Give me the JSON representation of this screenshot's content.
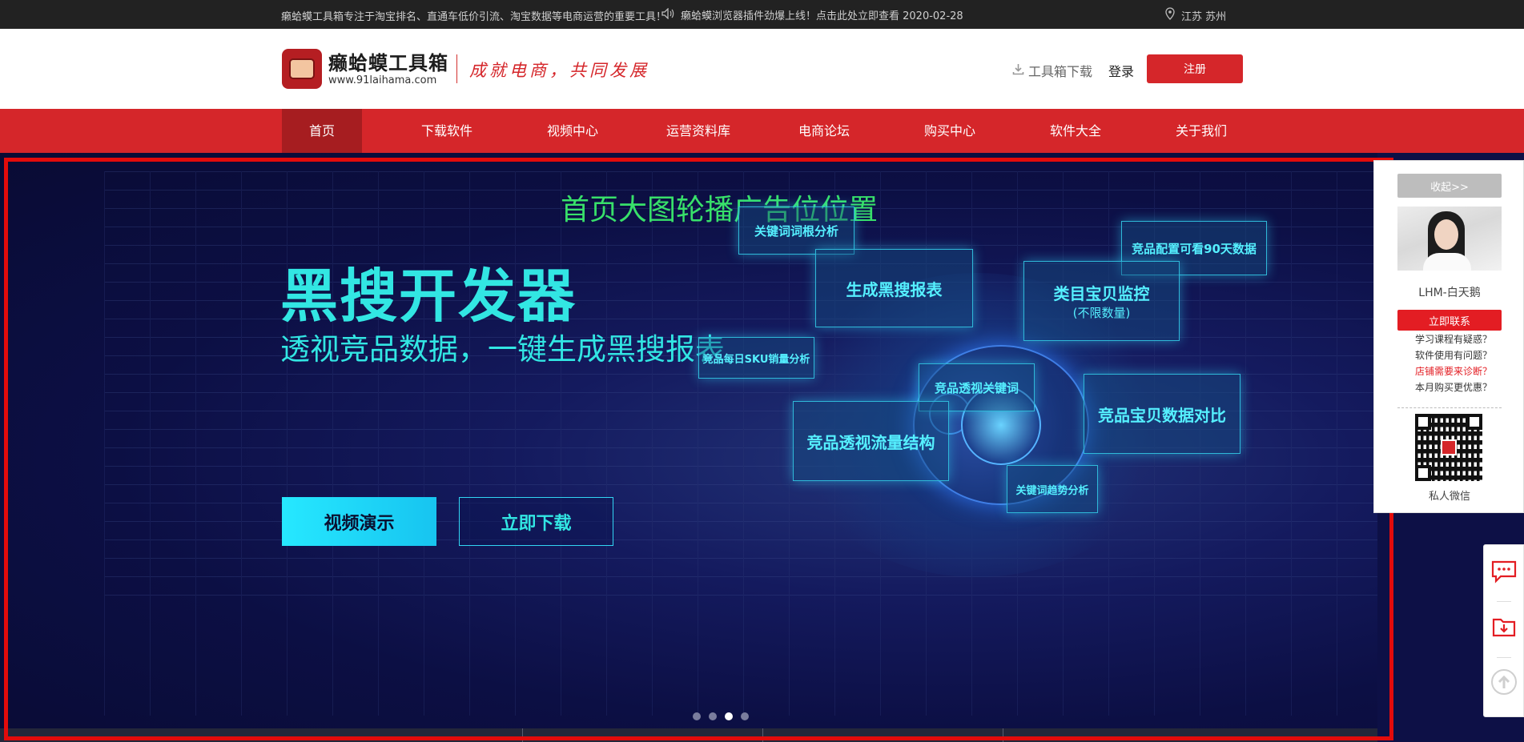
{
  "topbar": {
    "intro": "癞蛤蟆工具箱专注于淘宝排名、直通车低价引流、淘宝数据等电商运营的重要工具！",
    "notice": "癞蛤蟆浏览器插件劲爆上线！点击此处立即查看 2020-02-28",
    "location": "江苏 苏州"
  },
  "header": {
    "logo_name": "癞蛤蟆工具箱",
    "logo_url": "www.91laihama.com",
    "slogan": "成就电商，共同发展",
    "download": "工具箱下载",
    "login": "登录",
    "register": "注册"
  },
  "nav": {
    "items": [
      "首页",
      "下载软件",
      "视频中心",
      "运营资料库",
      "电商论坛",
      "购买中心",
      "软件大全",
      "关于我们"
    ],
    "active": 0
  },
  "banner": {
    "ad_label": "首页大图轮播广告位位置",
    "title": "黑搜开发器",
    "subtitle": "透视竞品数据，一键生成黑搜报表",
    "btn_video": "视频演示",
    "btn_download": "立即下载",
    "cards": [
      "关键词词根分析",
      "竞品配置可看90天数据",
      "生成黑搜报表",
      "类目宝贝监控",
      "(不限数量)",
      "竞品每日SKU销量分析",
      "竞品透视关键词",
      "竞品宝贝数据对比",
      "竞品透视流量结构",
      "关键词趋势分析"
    ],
    "slide_count": 4,
    "active_slide": 2
  },
  "side_panel": {
    "collapse": "收起>>",
    "agent_name": "LHM-白天鹅",
    "contact": "立即联系",
    "faq": [
      "学习课程有疑惑？",
      "软件使用有问题？",
      "店铺需要来诊断？",
      "本月购买更优惠？"
    ],
    "wechat": "私人微信"
  },
  "float_tools": [
    "chat-icon",
    "download-folder-icon",
    "back-to-top-icon"
  ],
  "colors": {
    "brand_red": "#d5262a",
    "nav_active": "#a61d20",
    "banner_cyan": "#32e6e3",
    "banner_green": "#38e06a",
    "banner_bg": "#0d1046"
  }
}
